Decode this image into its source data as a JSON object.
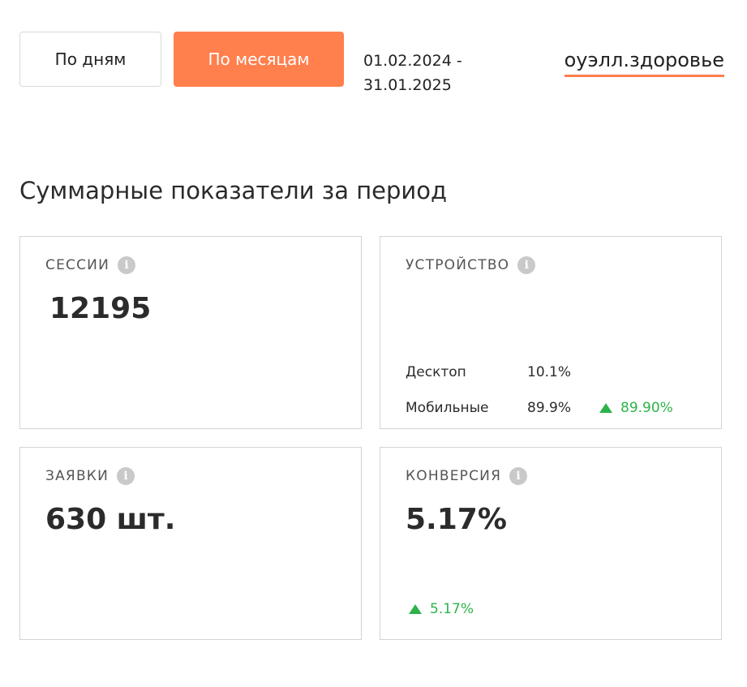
{
  "toolbar": {
    "by_days_label": "По дням",
    "by_months_label": "По месяцам",
    "date_from": "01.02.2024 -",
    "date_to": "31.01.2025",
    "project_name": "оуэлл.здоровье"
  },
  "section": {
    "title": "Суммарные показатели за период"
  },
  "cards": {
    "sessions": {
      "label": "СЕССИИ",
      "value": "12195"
    },
    "device": {
      "label": "УСТРОЙСТВО",
      "rows": [
        {
          "name": "Десктоп",
          "value": "10.1%"
        },
        {
          "name": "Мобильные",
          "value": "89.9%",
          "trend": "89.90%"
        }
      ]
    },
    "leads": {
      "label": "ЗАЯВКИ",
      "value": "630 шт."
    },
    "conversion": {
      "label": "КОНВЕРСИЯ",
      "value": "5.17%",
      "trend": "5.17%"
    }
  },
  "icons": {
    "info": "i",
    "trend_up": "triangle-up-icon"
  },
  "colors": {
    "accent": "#ff7f4d",
    "positive": "#2eb24a",
    "info_icon": "#c9c9c9",
    "border": "#d4d4d4"
  }
}
